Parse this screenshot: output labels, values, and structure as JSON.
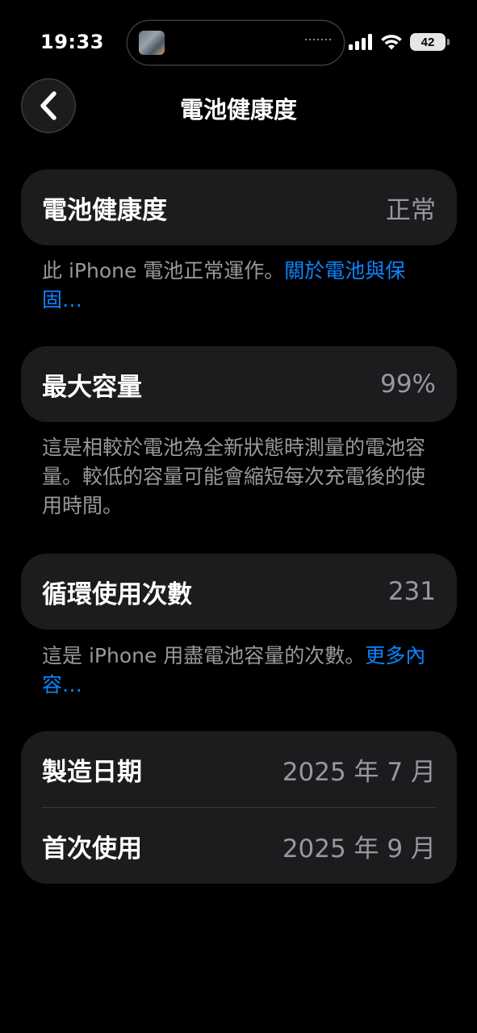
{
  "status_bar": {
    "time": "19:33",
    "battery_level": "42",
    "icons": [
      "cellular-signal-icon",
      "wifi-icon",
      "battery-icon"
    ]
  },
  "nav": {
    "title": "電池健康度",
    "back_icon": "chevron-left-icon"
  },
  "health": {
    "label": "電池健康度",
    "value": "正常",
    "footnote_text": "此 iPhone 電池正常運作。",
    "footnote_link": "關於電池與保固…"
  },
  "capacity": {
    "label": "最大容量",
    "value": "99%",
    "footnote": "這是相較於電池為全新狀態時測量的電池容量。較低的容量可能會縮短每次充電後的使用時間。"
  },
  "cycles": {
    "label": "循環使用次數",
    "value": "231",
    "footnote_text": "這是 iPhone 用盡電池容量的次數。",
    "footnote_link": "更多內容…"
  },
  "dates": {
    "manufacture_label": "製造日期",
    "manufacture_value": "2025 年 7 月",
    "first_use_label": "首次使用",
    "first_use_value": "2025 年 9 月"
  },
  "colors": {
    "background": "#000000",
    "card": "#1c1c1e",
    "secondary_text": "#98989d",
    "link": "#0a84ff"
  }
}
